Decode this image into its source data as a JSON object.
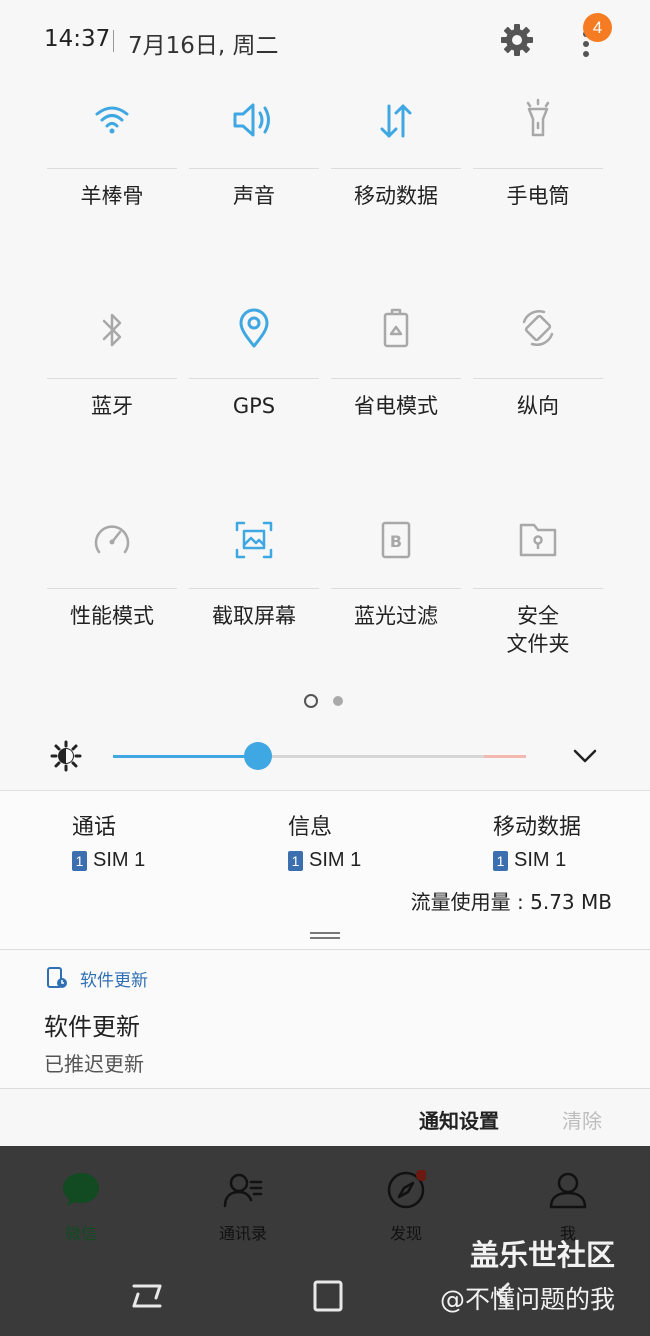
{
  "status": {
    "time": "14:37",
    "date": "7月16日, 周二",
    "badge_count": "4"
  },
  "tiles": [
    {
      "label": "羊棒骨",
      "icon": "wifi-icon",
      "active": true
    },
    {
      "label": "声音",
      "icon": "sound-icon",
      "active": true
    },
    {
      "label": "移动数据",
      "icon": "mobile-data-icon",
      "active": true
    },
    {
      "label": "手电筒",
      "icon": "flashlight-icon",
      "active": false
    },
    {
      "label": "蓝牙",
      "icon": "bluetooth-icon",
      "active": false
    },
    {
      "label": "GPS",
      "icon": "location-icon",
      "active": true
    },
    {
      "label": "省电模式",
      "icon": "battery-saver-icon",
      "active": false
    },
    {
      "label": "纵向",
      "icon": "rotate-icon",
      "active": false
    },
    {
      "label": "性能模式",
      "icon": "performance-icon",
      "active": false
    },
    {
      "label": "截取屏幕",
      "icon": "screenshot-icon",
      "active": true
    },
    {
      "label": "蓝光过滤",
      "icon": "blue-light-filter-icon",
      "active": false
    },
    {
      "label": "安全\n文件夹",
      "icon": "secure-folder-icon",
      "active": false
    }
  ],
  "brightness": {
    "level": 0.35
  },
  "sim": [
    {
      "title": "通话",
      "sim_label": "SIM 1",
      "sim_number": "1"
    },
    {
      "title": "信息",
      "sim_label": "SIM 1",
      "sim_number": "1"
    },
    {
      "title": "移动数据",
      "sim_label": "SIM 1",
      "sim_number": "1"
    }
  ],
  "data_usage": "流量使用量 : 5.73 MB",
  "notification": {
    "app": "软件更新",
    "title": "软件更新",
    "subtitle": "已推迟更新"
  },
  "actions": {
    "settings": "通知设置",
    "clear": "清除"
  },
  "wechat_tabs": [
    {
      "label": "微信",
      "icon": "chat-icon"
    },
    {
      "label": "通讯录",
      "icon": "contacts-icon"
    },
    {
      "label": "发现",
      "icon": "compass-icon"
    },
    {
      "label": "我",
      "icon": "profile-icon"
    }
  ],
  "watermark": {
    "line1": "盖乐世社区",
    "line2": "@不懂问题的我"
  },
  "colors": {
    "accent": "#3fa7e2",
    "badge": "#f57c22",
    "inactive_icon": "#a8a8a8"
  }
}
